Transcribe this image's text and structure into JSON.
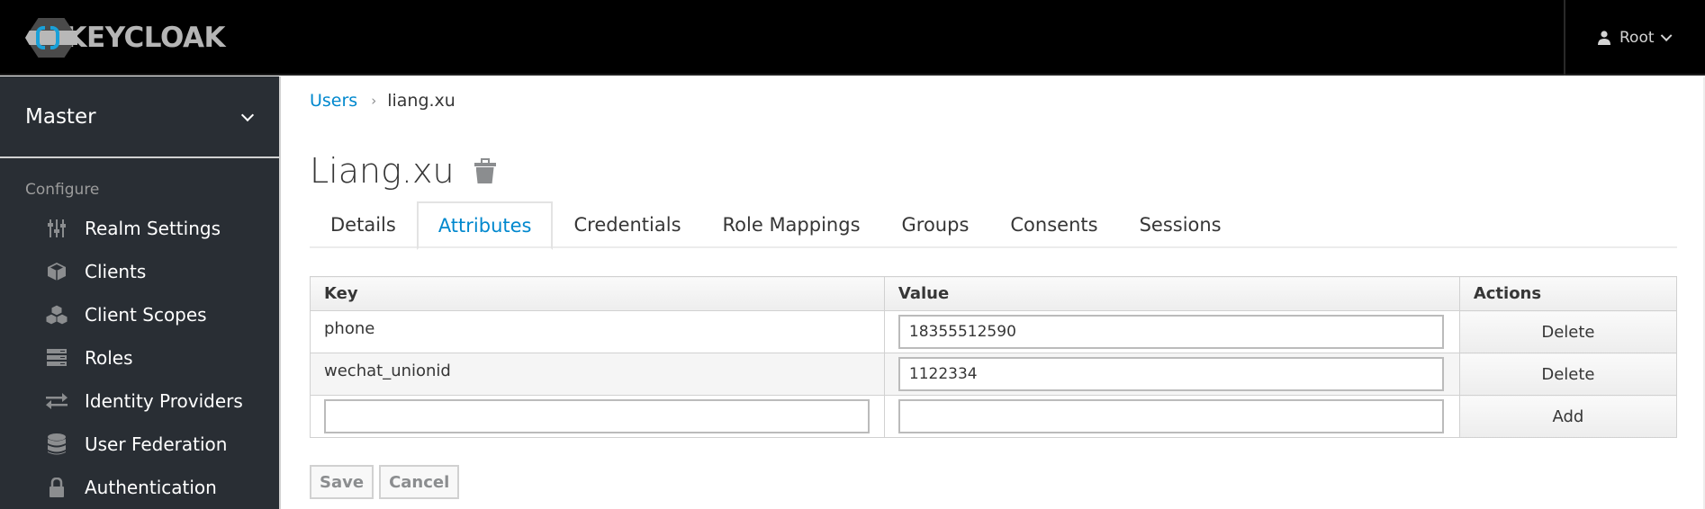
{
  "header": {
    "logo_text": "KEYCLOAK",
    "user": {
      "icon": "user-icon",
      "name": "Root",
      "chevron": "chevron-down-icon"
    }
  },
  "sidebar": {
    "realm": "Master",
    "section_label": "Configure",
    "items": [
      {
        "label": "Realm Settings",
        "icon": "sliders-icon"
      },
      {
        "label": "Clients",
        "icon": "cube-icon"
      },
      {
        "label": "Client Scopes",
        "icon": "cubes-icon"
      },
      {
        "label": "Roles",
        "icon": "server-icon"
      },
      {
        "label": "Identity Providers",
        "icon": "exchange-icon"
      },
      {
        "label": "User Federation",
        "icon": "database-icon"
      },
      {
        "label": "Authentication",
        "icon": "lock-icon"
      }
    ]
  },
  "main": {
    "breadcrumb": {
      "parent": "Users",
      "separator": "›",
      "current": "liang.xu"
    },
    "title": "Liang.xu",
    "tabs": [
      {
        "label": "Details",
        "active": false
      },
      {
        "label": "Attributes",
        "active": true
      },
      {
        "label": "Credentials",
        "active": false
      },
      {
        "label": "Role Mappings",
        "active": false
      },
      {
        "label": "Groups",
        "active": false
      },
      {
        "label": "Consents",
        "active": false
      },
      {
        "label": "Sessions",
        "active": false
      }
    ],
    "table": {
      "columns": [
        "Key",
        "Value",
        "Actions"
      ],
      "rows": [
        {
          "key": "phone",
          "value": "18355512590",
          "action": "Delete"
        },
        {
          "key": "wechat_unionid",
          "value": "1122334",
          "action": "Delete"
        }
      ],
      "new_row": {
        "key": "",
        "value": "",
        "action": "Add"
      }
    },
    "buttons": {
      "save": "Save",
      "cancel": "Cancel"
    }
  },
  "colors": {
    "accent": "#0088ce",
    "sidebar_bg": "#292e34",
    "header_bg": "#000000"
  }
}
